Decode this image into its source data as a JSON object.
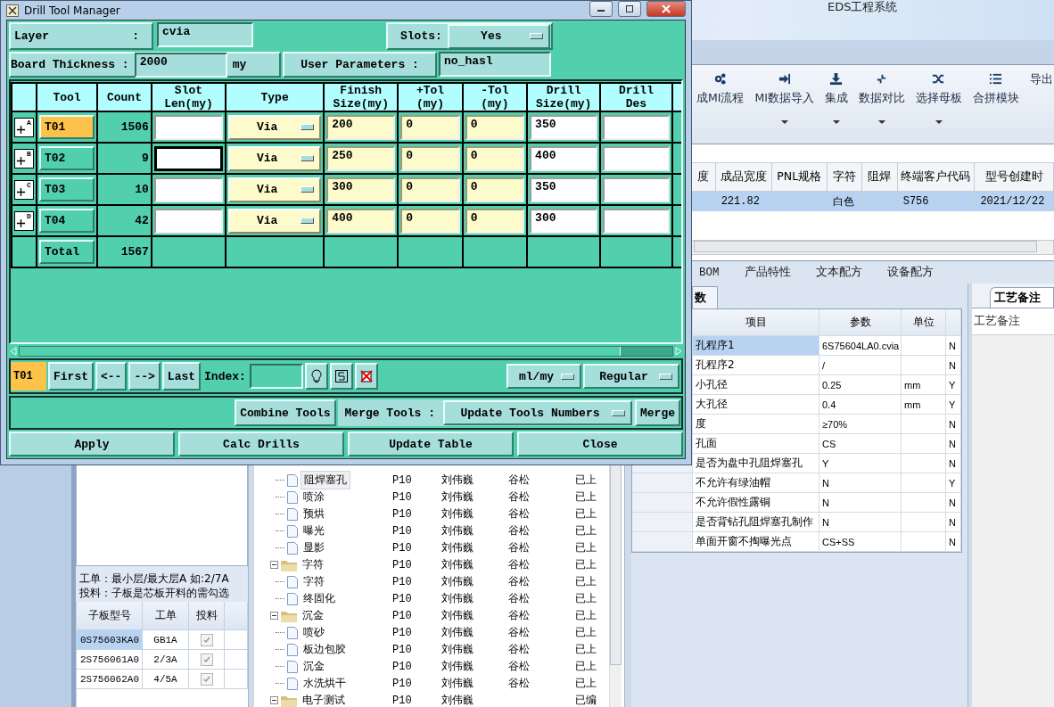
{
  "dialog": {
    "title": "Drill Tool Manager",
    "layer": {
      "label": "Layer",
      "separator": ":",
      "value": "cvia"
    },
    "slots": {
      "label": "Slots:",
      "value": "Yes"
    },
    "board_thickness": {
      "label": "Board Thickness :",
      "value": "2000",
      "unit": "my"
    },
    "user_parameters": {
      "label": "User Parameters :",
      "value": "no_hasl"
    },
    "columns": [
      "Tool",
      "Count",
      "Slot\nLen(my)",
      "Type",
      "Finish\nSize(my)",
      "+Tol\n(my)",
      "-Tol\n(my)",
      "Drill\nSize(my)",
      "Drill\nDes"
    ],
    "rows": [
      {
        "marker": "A",
        "tool": "T01",
        "selected": true,
        "count": "1506",
        "slot_len_focused": false,
        "type": "Via",
        "finish": "200",
        "plus_tol": "0",
        "minus_tol": "0",
        "drill_size": "350"
      },
      {
        "marker": "B",
        "tool": "T02",
        "selected": false,
        "count": "9",
        "slot_len_focused": true,
        "type": "Via",
        "finish": "250",
        "plus_tol": "0",
        "minus_tol": "0",
        "drill_size": "400"
      },
      {
        "marker": "C",
        "tool": "T03",
        "selected": false,
        "count": "10",
        "slot_len_focused": false,
        "type": "Via",
        "finish": "300",
        "plus_tol": "0",
        "minus_tol": "0",
        "drill_size": "350"
      },
      {
        "marker": "D",
        "tool": "T04",
        "selected": false,
        "count": "42",
        "slot_len_focused": false,
        "type": "Via",
        "finish": "400",
        "plus_tol": "0",
        "minus_tol": "0",
        "drill_size": "300"
      }
    ],
    "total": {
      "label": "Total",
      "count": "1567"
    },
    "current_tool": "T01",
    "nav_buttons": [
      "First",
      "<--",
      "-->",
      "Last"
    ],
    "index_label": "Index:",
    "unit_mode": "ml/my",
    "drill_mode": "Regular",
    "combine_button": "Combine Tools",
    "merge_label": "Merge Tools :",
    "merge_option": "Update Tools Numbers",
    "merge_button": "Merge",
    "actions": [
      "Apply",
      "Calc Drills",
      "Update Table",
      "Close"
    ]
  },
  "app": {
    "title": "EDS工程系统",
    "ribbon": [
      {
        "label": "成MI流程",
        "dropdown": false
      },
      {
        "label": "MI数据导入",
        "dropdown": true
      },
      {
        "label": "集成",
        "dropdown": true
      },
      {
        "label": "数据对比",
        "dropdown": true
      },
      {
        "label": "选择母板",
        "dropdown": true
      },
      {
        "label": "合拼模块",
        "dropdown": false
      },
      {
        "label": "导出",
        "dropdown": false
      }
    ],
    "grid": {
      "columns": [
        "度",
        "成品宽度",
        "PNL规格",
        "字符",
        "阻焊",
        "终端客户代码",
        "型号创建时"
      ],
      "rows": [
        {
          "selected": true,
          "cells": [
            null,
            "221.82",
            null,
            "白色",
            null,
            "S756",
            "2021/12/22"
          ]
        }
      ]
    },
    "tabs": [
      {
        "label": "BOM",
        "selected": false
      },
      {
        "label": "产品特性",
        "selected": false
      },
      {
        "label": "文本配方",
        "selected": false
      },
      {
        "label": "设备配方",
        "selected": false
      }
    ],
    "left_panel": {
      "notes": [
        "工单：最小层/最大层A 如:2/7A",
        "投料：子板是芯板开料的需勾选"
      ],
      "columns": [
        "子板型号",
        "工单",
        "投料"
      ],
      "rows": [
        {
          "board": "0S75603KA0",
          "order": "GB1A",
          "checked": true,
          "selected": true
        },
        {
          "board": "2S756061A0",
          "order": "2/3A",
          "checked": true,
          "selected": false
        },
        {
          "board": "2S756062A0",
          "order": "4/5A",
          "checked": true,
          "selected": false
        }
      ]
    },
    "tree": {
      "continued": [
        {
          "name": "阻焊塞孔",
          "column_2": "P10",
          "column_3": "刘伟巍",
          "column_4": "谷松",
          "column_5": "已上",
          "selected": true
        },
        {
          "name": "喷涂",
          "column_2": "P10",
          "column_3": "刘伟巍",
          "column_4": "谷松",
          "column_5": "已上",
          "selected": false
        },
        {
          "name": "预烘",
          "column_2": "P10",
          "column_3": "刘伟巍",
          "column_4": "谷松",
          "column_5": "已上",
          "selected": false
        },
        {
          "name": "曝光",
          "column_2": "P10",
          "column_3": "刘伟巍",
          "column_4": "谷松",
          "column_5": "已上",
          "selected": false
        },
        {
          "name": "显影",
          "column_2": "P10",
          "column_3": "刘伟巍",
          "column_4": "谷松",
          "column_5": "已上",
          "selected": false
        }
      ],
      "folders": [
        {
          "name": "字符",
          "column_2": "P10",
          "column_3": "刘伟巍",
          "column_4": "谷松",
          "column_5": "已上",
          "expanded": true,
          "children": [
            {
              "name": "字符",
              "column_2": "P10",
              "column_3": "刘伟巍",
              "column_4": "谷松",
              "column_5": "已上",
              "selected": false
            },
            {
              "name": "终固化",
              "column_2": "P10",
              "column_3": "刘伟巍",
              "column_4": "谷松",
              "column_5": "已上",
              "selected": false
            }
          ]
        },
        {
          "name": "沉金",
          "column_2": "P10",
          "column_3": "刘伟巍",
          "column_4": "谷松",
          "column_5": "已上",
          "expanded": true,
          "children": [
            {
              "name": "喷砂",
              "column_2": "P10",
              "column_3": "刘伟巍",
              "column_4": "谷松",
              "column_5": "已上",
              "selected": false
            },
            {
              "name": "板边包胶",
              "column_2": "P10",
              "column_3": "刘伟巍",
              "column_4": "谷松",
              "column_5": "已上",
              "selected": false
            },
            {
              "name": "沉金",
              "column_2": "P10",
              "column_3": "刘伟巍",
              "column_4": "谷松",
              "column_5": "已上",
              "selected": false
            },
            {
              "name": "水洗烘干",
              "column_2": "P10",
              "column_3": "刘伟巍",
              "column_4": "谷松",
              "column_5": "已上",
              "selected": false
            }
          ]
        },
        {
          "name": "电子测试",
          "column_2": "P10",
          "column_3": "刘伟巍",
          "column_5": "已编",
          "expanded": true
        }
      ]
    },
    "params": {
      "tab": {
        "label": "数",
        "selected": true
      },
      "columns": [
        "项目",
        "参数",
        "单位"
      ],
      "rows": [
        {
          "item": "孔程序1",
          "value": "6S75604LA0.cvia",
          "flag": "N",
          "selected": true
        },
        {
          "item": "孔程序2",
          "value": "/",
          "flag": "N",
          "selected": false
        },
        {
          "item": "小孔径",
          "value": "0.25",
          "unit": "mm",
          "flag": "Y",
          "selected": false
        },
        {
          "item": "大孔径",
          "value": "0.4",
          "unit": "mm",
          "flag": "Y",
          "selected": false
        },
        {
          "item": "度",
          "value": "≥70%",
          "flag": "N",
          "selected": false
        },
        {
          "item": "孔面",
          "value": "CS",
          "flag": "N",
          "selected": false
        },
        {
          "item": "是否为盘中孔阻焊塞孔",
          "value": "Y",
          "flag": "N",
          "selected": false
        },
        {
          "item": "不允许有绿油帽",
          "value": "N",
          "flag": "Y",
          "selected": false
        },
        {
          "item": "不允许假性露铜",
          "value": "N",
          "flag": "N",
          "selected": false
        },
        {
          "item": "是否背钻孔阻焊塞孔制作",
          "value": "N",
          "flag": "N",
          "selected": false
        },
        {
          "item": "单面开窗不掏曝光点",
          "value": "CS+SS",
          "flag": "N",
          "selected": false
        }
      ]
    },
    "remarks": {
      "tab": {
        "label": "工艺备注",
        "selected": true
      },
      "label": "工艺备注"
    }
  }
}
